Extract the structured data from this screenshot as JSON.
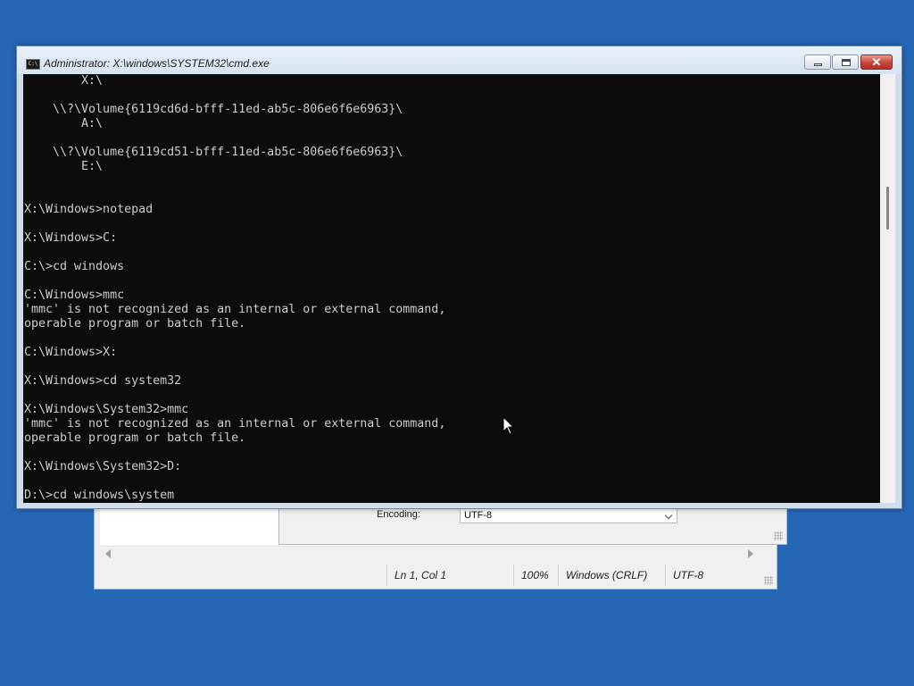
{
  "notepad": {
    "status": {
      "position": "Ln 1, Col 1",
      "zoom": "100%",
      "line_ending": "Windows (CRLF)",
      "encoding": "UTF-8"
    }
  },
  "save_dialog": {
    "encoding_label": "Encoding:",
    "encoding_value": "UTF-8"
  },
  "cmd": {
    "title": "Administrator: X:\\windows\\SYSTEM32\\cmd.exe",
    "icon_text": "C:\\",
    "close_glyph": "✕",
    "lines": [
      "        X:\\",
      "",
      "    \\\\?\\Volume{6119cd6d-bfff-11ed-ab5c-806e6f6e6963}\\",
      "        A:\\",
      "",
      "    \\\\?\\Volume{6119cd51-bfff-11ed-ab5c-806e6f6e6963}\\",
      "        E:\\",
      "",
      "",
      "X:\\Windows>notepad",
      "",
      "X:\\Windows>C:",
      "",
      "C:\\>cd windows",
      "",
      "C:\\Windows>mmc",
      "'mmc' is not recognized as an internal or external command,",
      "operable program or batch file.",
      "",
      "C:\\Windows>X:",
      "",
      "X:\\Windows>cd system32",
      "",
      "X:\\Windows\\System32>mmc",
      "'mmc' is not recognized as an internal or external command,",
      "operable program or batch file.",
      "",
      "X:\\Windows\\System32>D:",
      "",
      "D:\\>cd windows\\system"
    ]
  }
}
